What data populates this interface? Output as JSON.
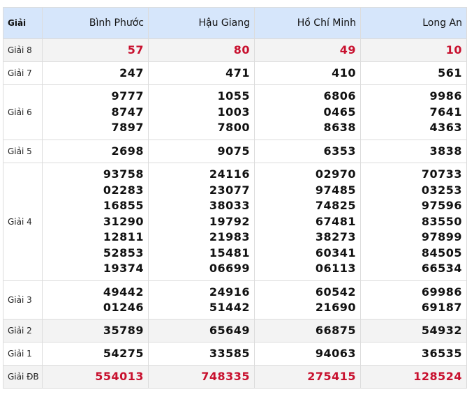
{
  "header": {
    "label": "Giải",
    "provinces": [
      "Bình Phước",
      "Hậu Giang",
      "Hồ Chí Minh",
      "Long An"
    ]
  },
  "rows": [
    {
      "prize": "Giải 8",
      "values": [
        [
          "57"
        ],
        [
          "80"
        ],
        [
          "49"
        ],
        [
          "10"
        ]
      ]
    },
    {
      "prize": "Giải 7",
      "values": [
        [
          "247"
        ],
        [
          "471"
        ],
        [
          "410"
        ],
        [
          "561"
        ]
      ]
    },
    {
      "prize": "Giải 6",
      "values": [
        [
          "9777",
          "8747",
          "7897"
        ],
        [
          "1055",
          "1003",
          "7800"
        ],
        [
          "6806",
          "0465",
          "8638"
        ],
        [
          "9986",
          "7641",
          "4363"
        ]
      ]
    },
    {
      "prize": "Giải 5",
      "values": [
        [
          "2698"
        ],
        [
          "9075"
        ],
        [
          "6353"
        ],
        [
          "3838"
        ]
      ]
    },
    {
      "prize": "Giải 4",
      "values": [
        [
          "93758",
          "02283",
          "16855",
          "31290",
          "12811",
          "52853",
          "19374"
        ],
        [
          "24116",
          "23077",
          "38033",
          "19792",
          "21983",
          "15481",
          "06699"
        ],
        [
          "02970",
          "97485",
          "74825",
          "67481",
          "38273",
          "60341",
          "06113"
        ],
        [
          "70733",
          "03253",
          "97596",
          "83550",
          "97899",
          "84505",
          "66534"
        ]
      ]
    },
    {
      "prize": "Giải 3",
      "values": [
        [
          "49442",
          "01246"
        ],
        [
          "24916",
          "51442"
        ],
        [
          "60542",
          "21690"
        ],
        [
          "69986",
          "69187"
        ]
      ]
    },
    {
      "prize": "Giải 2",
      "values": [
        [
          "35789"
        ],
        [
          "65649"
        ],
        [
          "66875"
        ],
        [
          "54932"
        ]
      ]
    },
    {
      "prize": "Giải 1",
      "values": [
        [
          "54275"
        ],
        [
          "33585"
        ],
        [
          "94063"
        ],
        [
          "36535"
        ]
      ]
    },
    {
      "prize": "Giải ĐB",
      "values": [
        [
          "554013"
        ],
        [
          "748335"
        ],
        [
          "275415"
        ],
        [
          "128524"
        ]
      ]
    }
  ],
  "colors": {
    "header_bg": "#d6e6fb",
    "alt_row_bg": "#f3f3f3",
    "highlight_number": "#c8102e"
  }
}
